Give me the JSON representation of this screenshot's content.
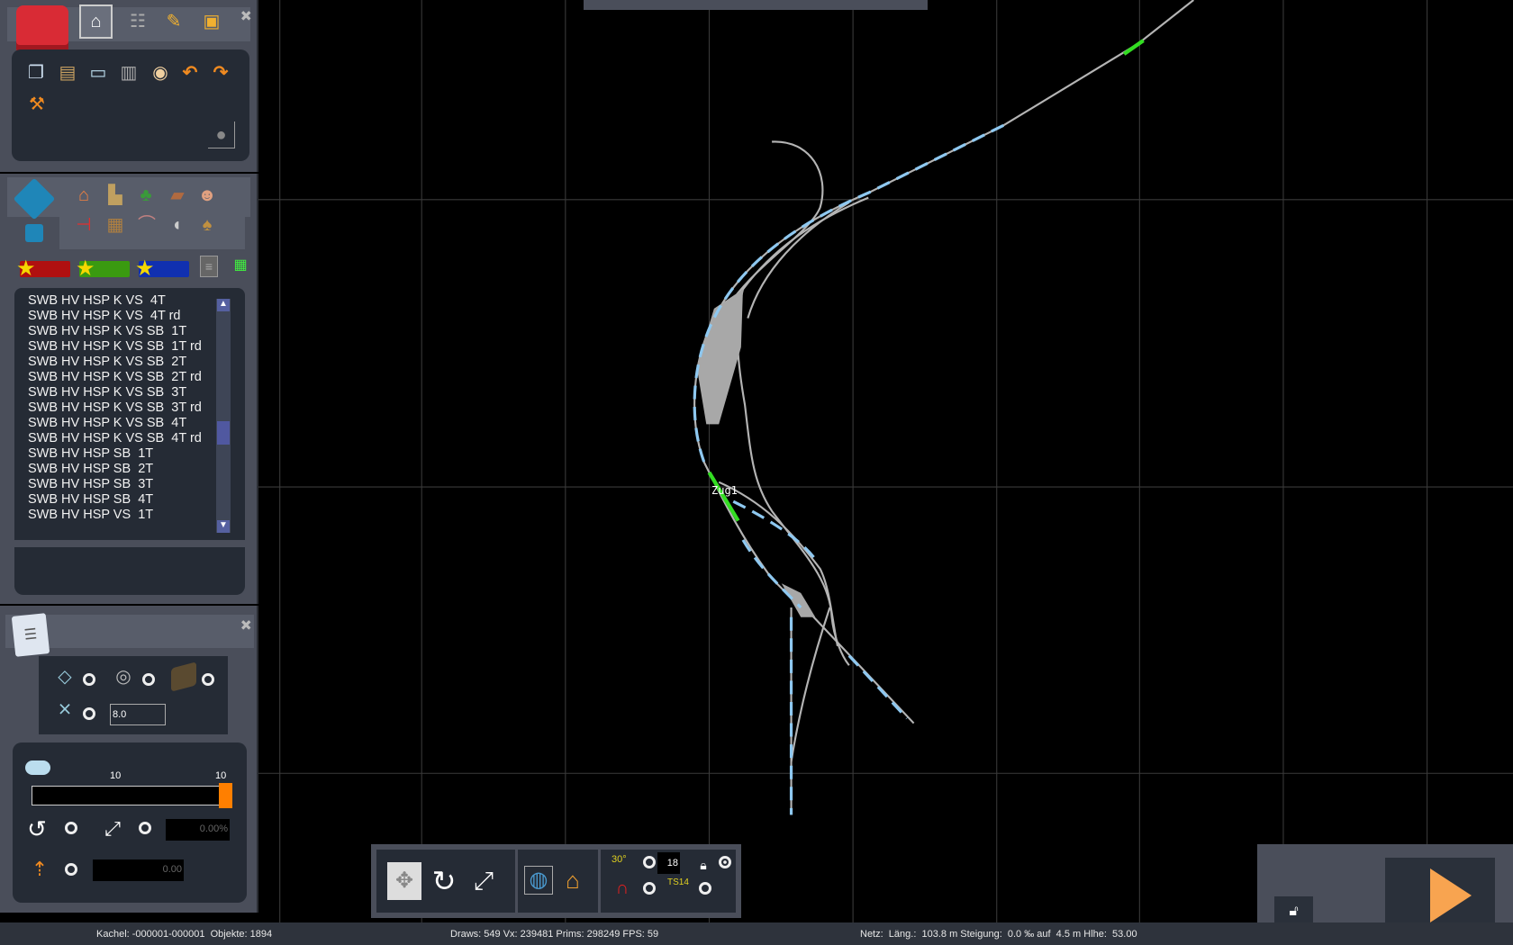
{
  "colors": {
    "panel": "#4a4e5a",
    "inner": "#252b35",
    "accent": "#ff7f00",
    "track": "#b4b4b4",
    "track_blue": "#8ec8f0",
    "train": "#33dd22"
  },
  "toolbox": {
    "tabs": [
      {
        "icon": "home-icon",
        "selected": true
      },
      {
        "icon": "track-icon"
      },
      {
        "icon": "paintbrush-icon"
      },
      {
        "icon": "train-icon"
      }
    ],
    "tools": [
      "copy-icon",
      "paste-icon",
      "monitor-icon",
      "trash-icon",
      "measure-icon",
      "undo-icon",
      "redo-icon",
      "crane-icon"
    ]
  },
  "objects": {
    "categories_row1": [
      "house-icon",
      "factory-icon",
      "tree-icon",
      "landscape-icon",
      "person-icon"
    ],
    "categories_row2": [
      "signal-icon",
      "bench-icon",
      "bridge-icon",
      "speaker-icon",
      "sack-icon"
    ],
    "favorites": [
      "red",
      "green",
      "blue"
    ],
    "list": [
      "SWB HV HSP K VS  4T",
      "SWB HV HSP K VS  4T rd",
      "SWB HV HSP K VS SB  1T",
      "SWB HV HSP K VS SB  1T rd",
      "SWB HV HSP K VS SB  2T",
      "SWB HV HSP K VS SB  2T rd",
      "SWB HV HSP K VS SB  3T",
      "SWB HV HSP K VS SB  3T rd",
      "SWB HV HSP K VS SB  4T",
      "SWB HV HSP K VS SB  4T rd",
      "SWB HV HSP SB  1T",
      "SWB HV HSP SB  2T",
      "SWB HV HSP SB  3T",
      "SWB HV HSP SB  4T",
      "SWB HV HSP VS  1T"
    ],
    "scroll_position": 0.6
  },
  "properties": {
    "grid_value": "8.0",
    "slider_left_label": "10",
    "slider_right_label": "10",
    "slider_fraction": 1.0,
    "scale_value": "0.00%",
    "height_value": "0.00"
  },
  "toolbar": {
    "angle_label": "30°",
    "angle_value": "18",
    "ts_label": "TS14"
  },
  "map": {
    "train_label": "Zug1"
  },
  "status": {
    "tile": "Kachel: -000001-000001  Objekte: 1894",
    "render": "Draws: 549 Vx: 239481 Prims: 298249 FPS: 59",
    "track": "Netz:  Läng.:  103.8 m Steigung:  0.0 ‰ auf  4.5 m Hlhe:  53.00"
  }
}
